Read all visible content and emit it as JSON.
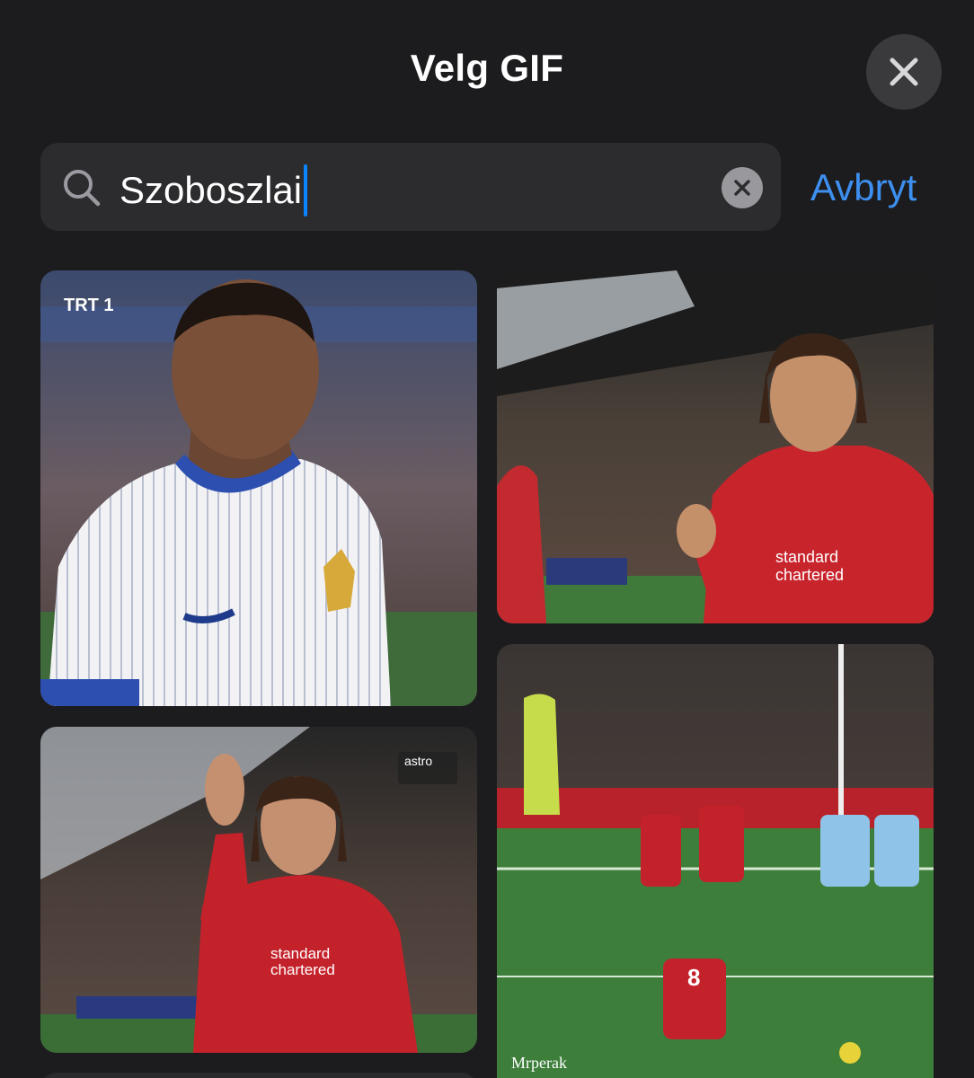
{
  "header": {
    "title": "Velg GIF",
    "close_icon": "close-icon"
  },
  "search": {
    "value": "Szoboszlai",
    "search_icon": "search-icon",
    "clear_icon": "clear-icon",
    "cancel_label": "Avbryt"
  },
  "colors": {
    "background": "#1c1c1e",
    "search_field": "#2c2c2e",
    "accent": "#3d8ff0"
  },
  "results": [
    {
      "overlay": "TRT 1"
    },
    {
      "overlay": ""
    },
    {
      "overlay": "astro"
    },
    {
      "overlay": "Mrperak"
    }
  ]
}
